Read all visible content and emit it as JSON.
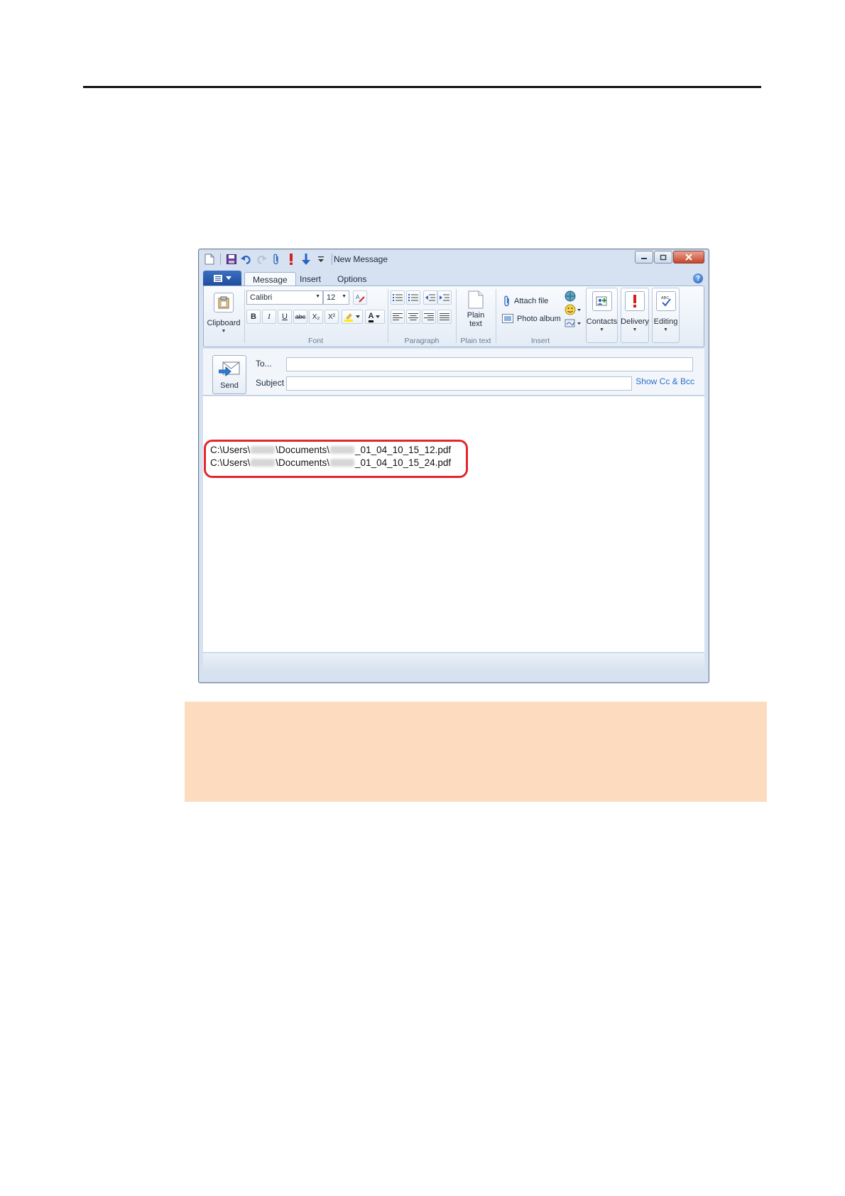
{
  "window": {
    "title": "New Message"
  },
  "tabs": [
    "Message",
    "Insert",
    "Options"
  ],
  "ribbon": {
    "clipboard": {
      "label": "Clipboard",
      "group_label": ""
    },
    "font": {
      "family": "Calibri",
      "size": "12",
      "group_label": "Font",
      "buttons": {
        "bold": "B",
        "italic": "I",
        "underline": "U",
        "strike": "abc",
        "subscript": "X₂",
        "superscript": "X²",
        "color": "A"
      }
    },
    "paragraph": {
      "group_label": "Paragraph"
    },
    "plain_text": {
      "label_line1": "Plain",
      "label_line2": "text",
      "group_label": "Plain text"
    },
    "insert": {
      "attach_file": "Attach file",
      "photo_album": "Photo album",
      "group_label": "Insert"
    },
    "contacts": {
      "label": "Contacts"
    },
    "delivery": {
      "label": "Delivery"
    },
    "editing": {
      "label": "Editing"
    }
  },
  "header": {
    "send_label": "Send",
    "to_label": "To...",
    "subject_label": "Subject",
    "show_cc_bcc": "Show Cc & Bcc",
    "to_value": "",
    "subject_value": ""
  },
  "body": {
    "attachments": [
      {
        "prefix": "C:\\Users\\",
        "middle": "\\Documents\\",
        "suffix": "_01_04_10_15_12.pdf"
      },
      {
        "prefix": "C:\\Users\\",
        "middle": "\\Documents\\",
        "suffix": "_01_04_10_15_24.pdf"
      }
    ]
  },
  "colors": {
    "callout": "#e3272d",
    "note_background": "#fddbbf",
    "link": "#2b6fc7"
  },
  "icons": [
    "new-doc-icon",
    "save-icon",
    "undo-icon",
    "redo-icon",
    "attach-icon",
    "priority-high-icon",
    "priority-low-icon",
    "help-icon",
    "paste-icon",
    "send-icon"
  ]
}
